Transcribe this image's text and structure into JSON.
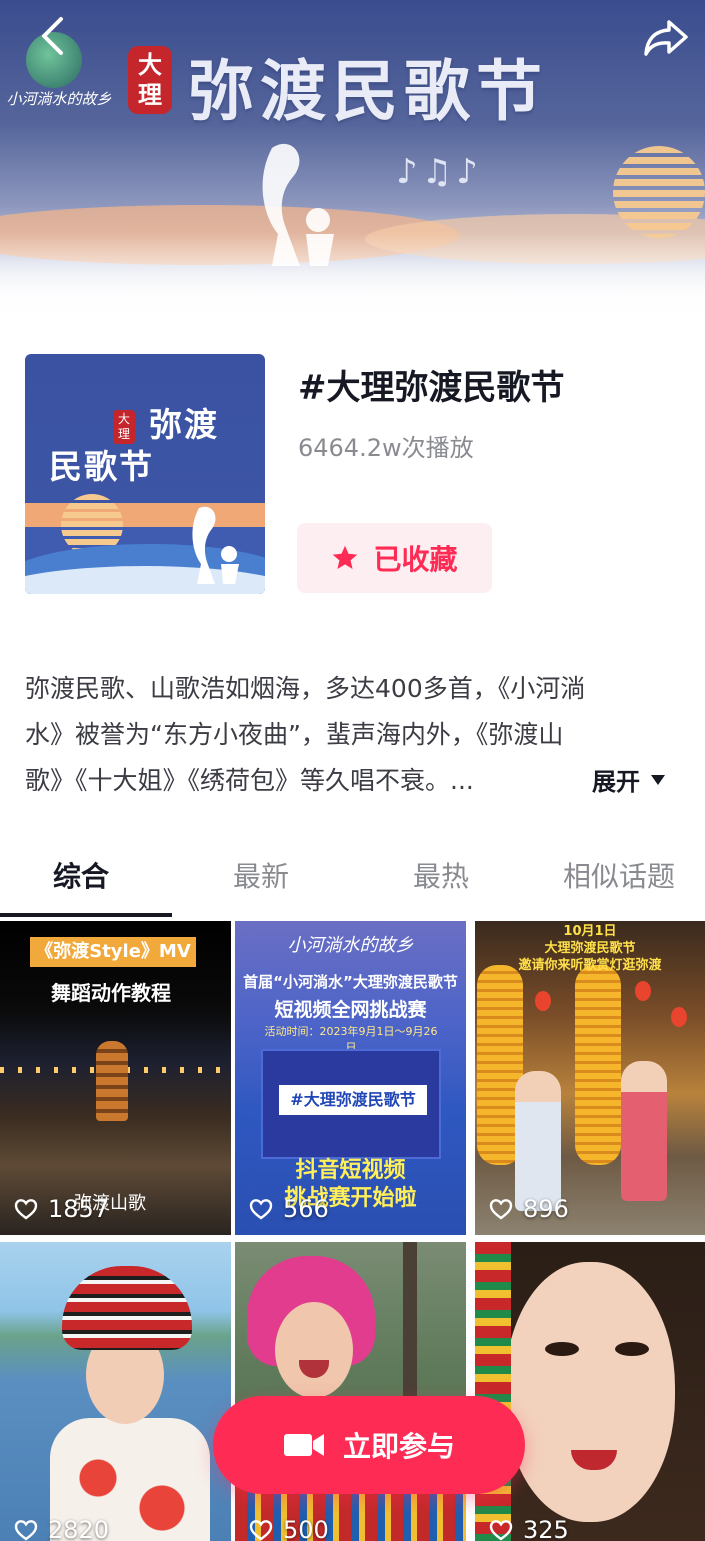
{
  "banner": {
    "title": "弥渡民歌节",
    "seal_text": "大理",
    "logo_text": "小河淌水的故乡"
  },
  "topic": {
    "title": "#大理弥渡民歌节",
    "plays": "6464.2w次播放",
    "favorite_label": "已收藏",
    "cover_title_line1": "弥渡",
    "cover_title_line2": "民歌节",
    "cover_seal": "大理"
  },
  "description": {
    "line1": "弥渡民歌、山歌浩如烟海，多达400多首，《小河淌",
    "line2": "水》被誉为“东方小夜曲”，蜚声海内外，《弥渡山",
    "line3": "歌》《十大姐》《绣荷包》等久唱不衰。...",
    "expand_label": "展开"
  },
  "tabs": [
    {
      "label": "综合",
      "active": true
    },
    {
      "label": "最新",
      "active": false
    },
    {
      "label": "最热",
      "active": false
    },
    {
      "label": "相似话题",
      "active": false
    }
  ],
  "videos": [
    {
      "likes": "1857",
      "tag": "《弥渡Style》MV",
      "subtitle": "舞蹈动作教程",
      "caption": "弥渡山歌"
    },
    {
      "likes": "566",
      "brand": "小河淌水的故乡",
      "line1": "首届“小河淌水”大理弥渡民歌节",
      "line2": "短视频全网挑战赛",
      "date": "活动时间：2023年9月1日～9月26日",
      "hashtag": "#大理弥渡民歌节",
      "slogan_line1": "抖音短视频",
      "slogan_line2": "挑战赛开始啦"
    },
    {
      "likes": "896",
      "date_line1": "10月1日",
      "date_line2": "大理弥渡民歌节",
      "date_line3": "邀请你来听歌赏灯逛弥渡"
    },
    {
      "likes": "2820"
    },
    {
      "likes": "500"
    },
    {
      "likes": "325"
    }
  ],
  "cta": {
    "label": "立即参与"
  },
  "colors": {
    "accent": "#fe2c55",
    "favorite_bg": "#fdeef1",
    "text_primary": "#161823",
    "text_secondary": "#8a8b91"
  }
}
